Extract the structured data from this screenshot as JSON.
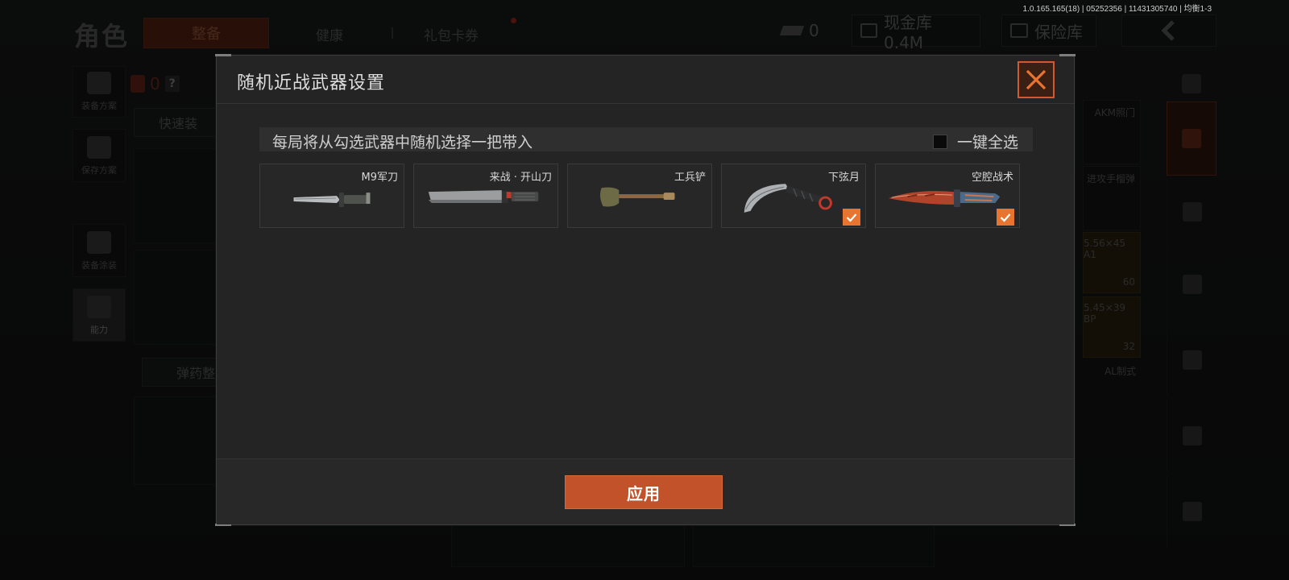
{
  "version_text": "1.0.165.165(18) | 05252356 | 11431305740 | 均衡1-3",
  "background": {
    "page_title": "角色",
    "tabs": [
      {
        "label": "整备",
        "active": true
      },
      {
        "label": "健康",
        "active": false
      },
      {
        "label": "礼包卡券",
        "active": false,
        "has_notification": true
      }
    ],
    "ticket_count": "0",
    "cash_label": "现金库 0.4M",
    "vault_label": "保险库",
    "left_menu": [
      {
        "label": "装备方案",
        "icon": "backpack-icon"
      },
      {
        "label": "保存方案",
        "icon": "download-icon"
      },
      {
        "label": "装备涂装",
        "icon": "helmet-icon"
      },
      {
        "label": "能力",
        "icon": "lightning-icon"
      }
    ],
    "carry_count": "0",
    "help_glyph": "?",
    "quick_equip_label": "快速装",
    "ammo_label": "弹药整",
    "right_slots": [
      {
        "label": "AKM照门"
      },
      {
        "label": "进攻手榴弹"
      },
      {
        "label": "5.56×45 A1",
        "count": "60"
      },
      {
        "label": "5.45×39 BP",
        "count": "32"
      },
      {
        "label": "AL制式"
      }
    ]
  },
  "modal": {
    "title": "随机近战武器设置",
    "hint": "每局将从勾选武器中随机选择一把带入",
    "select_all_label": "一键全选",
    "select_all_checked": false,
    "weapons": [
      {
        "name": "M9军刀",
        "checked": false,
        "icon": "bayonet-icon"
      },
      {
        "name": "来战 · 开山刀",
        "checked": false,
        "icon": "machete-icon"
      },
      {
        "name": "工兵铲",
        "checked": false,
        "icon": "shovel-icon"
      },
      {
        "name": "下弦月",
        "checked": true,
        "icon": "karambit-icon"
      },
      {
        "name": "空腔战术",
        "checked": true,
        "icon": "tactical-knife-icon"
      }
    ],
    "apply_label": "应用"
  },
  "colors": {
    "accent": "#e8742f",
    "apply_button": "#c2522a",
    "close_border": "#d05a2c",
    "modal_bg": "#242424"
  }
}
